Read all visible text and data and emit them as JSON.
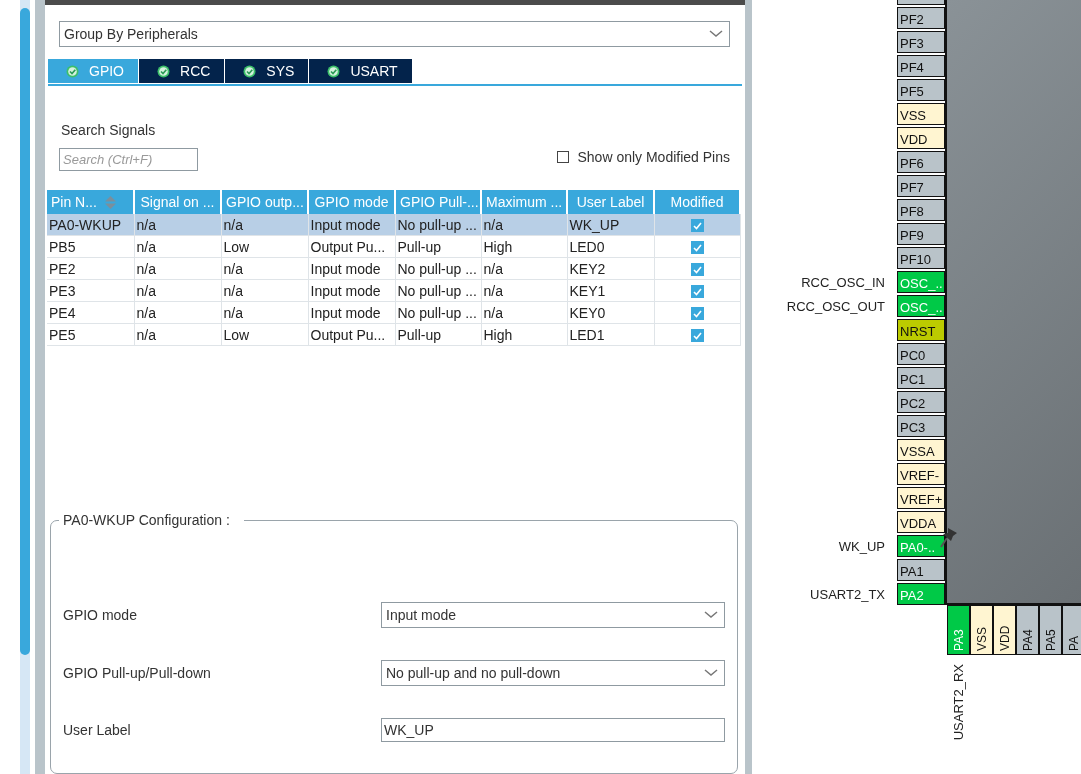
{
  "config_panel": {
    "group_by": "Group By Peripherals",
    "tabs": [
      {
        "label": "GPIO",
        "selected": true
      },
      {
        "label": "RCC",
        "selected": false
      },
      {
        "label": "SYS",
        "selected": false
      },
      {
        "label": "USART",
        "selected": false
      }
    ],
    "search": {
      "label": "Search Signals",
      "placeholder": "Search (Ctrl+F)"
    },
    "show_only_modified": {
      "label": "Show only Modified Pins",
      "checked": false
    },
    "table": {
      "columns": [
        {
          "label": "Pin N...",
          "sorted": true
        },
        {
          "label": "Signal on ...",
          "sorted": false
        },
        {
          "label": "GPIO outp...",
          "sorted": false
        },
        {
          "label": "GPIO mode",
          "sorted": false
        },
        {
          "label": "GPIO Pull-...",
          "sorted": false
        },
        {
          "label": "Maximum ...",
          "sorted": false
        },
        {
          "label": "User Label",
          "sorted": false
        },
        {
          "label": "Modified",
          "sorted": false
        }
      ],
      "rows": [
        {
          "cells": [
            "PA0-WKUP",
            "n/a",
            "n/a",
            "Input mode",
            "No pull-up ...",
            "n/a",
            "WK_UP"
          ],
          "modified": true,
          "selected": true
        },
        {
          "cells": [
            "PB5",
            "n/a",
            "Low",
            "Output Pu...",
            "Pull-up",
            "High",
            "LED0"
          ],
          "modified": true,
          "selected": false
        },
        {
          "cells": [
            "PE2",
            "n/a",
            "n/a",
            "Input mode",
            "No pull-up ...",
            "n/a",
            "KEY2"
          ],
          "modified": true,
          "selected": false
        },
        {
          "cells": [
            "PE3",
            "n/a",
            "n/a",
            "Input mode",
            "No pull-up ...",
            "n/a",
            "KEY1"
          ],
          "modified": true,
          "selected": false
        },
        {
          "cells": [
            "PE4",
            "n/a",
            "n/a",
            "Input mode",
            "No pull-up ...",
            "n/a",
            "KEY0"
          ],
          "modified": true,
          "selected": false
        },
        {
          "cells": [
            "PE5",
            "n/a",
            "Low",
            "Output Pu...",
            "Pull-up",
            "High",
            "LED1"
          ],
          "modified": true,
          "selected": false
        }
      ]
    },
    "pin_configuration": {
      "title": "PA0-WKUP Configuration :",
      "fields": [
        {
          "kind": "select",
          "label": "GPIO mode",
          "value": "Input mode"
        },
        {
          "kind": "select",
          "label": "GPIO Pull-up/Pull-down",
          "value": "No pull-up and no pull-down"
        },
        {
          "kind": "text",
          "label": "User Label",
          "value": "WK_UP"
        }
      ]
    }
  },
  "pinout": {
    "side_pins": [
      {
        "name": "PF2",
        "kind": "io",
        "pinned": false
      },
      {
        "name": "PF3",
        "kind": "io",
        "pinned": false
      },
      {
        "name": "PF4",
        "kind": "io",
        "pinned": false
      },
      {
        "name": "PF5",
        "kind": "io",
        "pinned": false
      },
      {
        "name": "VSS",
        "kind": "power",
        "pinned": false
      },
      {
        "name": "VDD",
        "kind": "power",
        "pinned": false
      },
      {
        "name": "PF6",
        "kind": "io",
        "pinned": false
      },
      {
        "name": "PF7",
        "kind": "io",
        "pinned": false
      },
      {
        "name": "PF8",
        "kind": "io",
        "pinned": false
      },
      {
        "name": "PF9",
        "kind": "io",
        "pinned": false
      },
      {
        "name": "PF10",
        "kind": "io",
        "pinned": false
      },
      {
        "name": "OSC_..",
        "kind": "assigned",
        "label": "RCC_OSC_IN",
        "pinned": false
      },
      {
        "name": "OSC_..",
        "kind": "assigned",
        "label": "RCC_OSC_OUT",
        "pinned": false
      },
      {
        "name": "NRST",
        "kind": "reset",
        "pinned": false
      },
      {
        "name": "PC0",
        "kind": "io",
        "pinned": false
      },
      {
        "name": "PC1",
        "kind": "io",
        "pinned": false
      },
      {
        "name": "PC2",
        "kind": "io",
        "pinned": false
      },
      {
        "name": "PC3",
        "kind": "io",
        "pinned": false
      },
      {
        "name": "VSSA",
        "kind": "power",
        "pinned": false
      },
      {
        "name": "VREF-",
        "kind": "power",
        "pinned": false
      },
      {
        "name": "VREF+",
        "kind": "power",
        "pinned": false
      },
      {
        "name": "VDDA",
        "kind": "power",
        "pinned": false
      },
      {
        "name": "PA0-..",
        "kind": "assigned",
        "label": "WK_UP",
        "pinned": true
      },
      {
        "name": "PA1",
        "kind": "io",
        "pinned": false
      },
      {
        "name": "PA2",
        "kind": "assigned",
        "label": "USART2_TX",
        "pinned": false
      }
    ],
    "bottom_pins": [
      {
        "name": "PA3",
        "kind": "assigned",
        "label": "USART2_RX"
      },
      {
        "name": "VSS",
        "kind": "power"
      },
      {
        "name": "VDD",
        "kind": "power"
      },
      {
        "name": "PA4",
        "kind": "io"
      },
      {
        "name": "PA5",
        "kind": "io"
      },
      {
        "name": "PA",
        "kind": "io"
      }
    ]
  }
}
